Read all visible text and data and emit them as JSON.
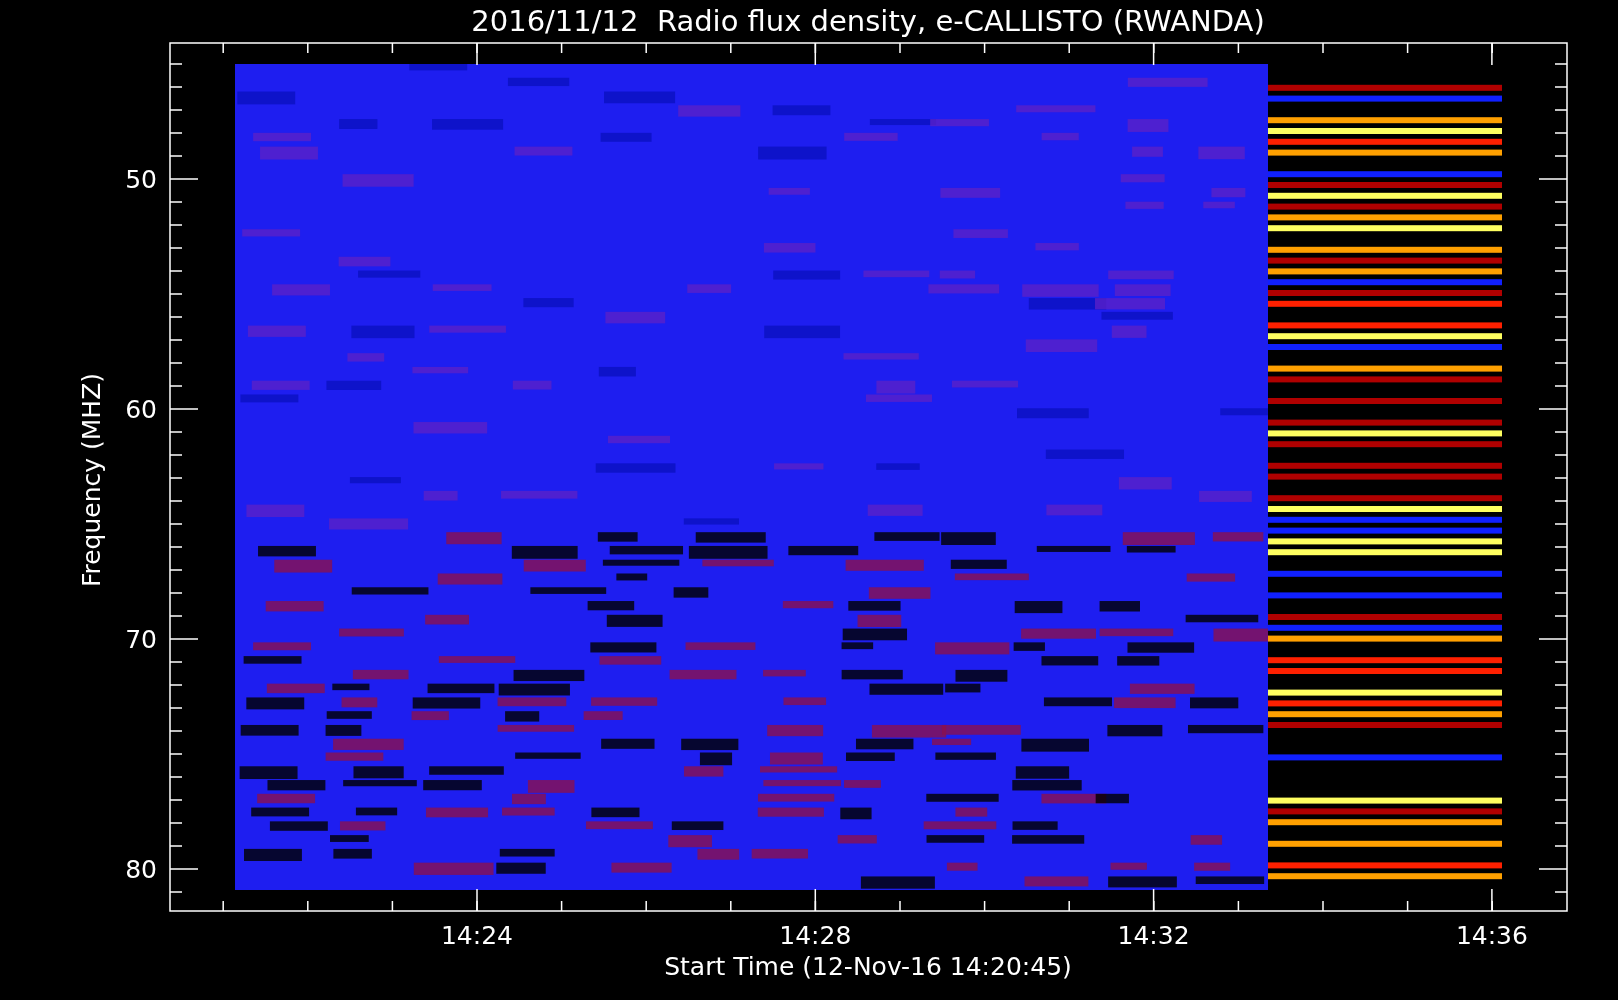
{
  "title": "2016/11/12  Radio flux density, e-CALLISTO (RWANDA)",
  "y_axis": {
    "label": "Frequency (MHZ)",
    "ticks": [
      "50",
      "60",
      "70",
      "80"
    ]
  },
  "x_axis": {
    "label": "Start Time (12-Nov-16 14:20:45)",
    "ticks": [
      "14:24",
      "14:28",
      "14:32",
      "14:36"
    ]
  }
}
